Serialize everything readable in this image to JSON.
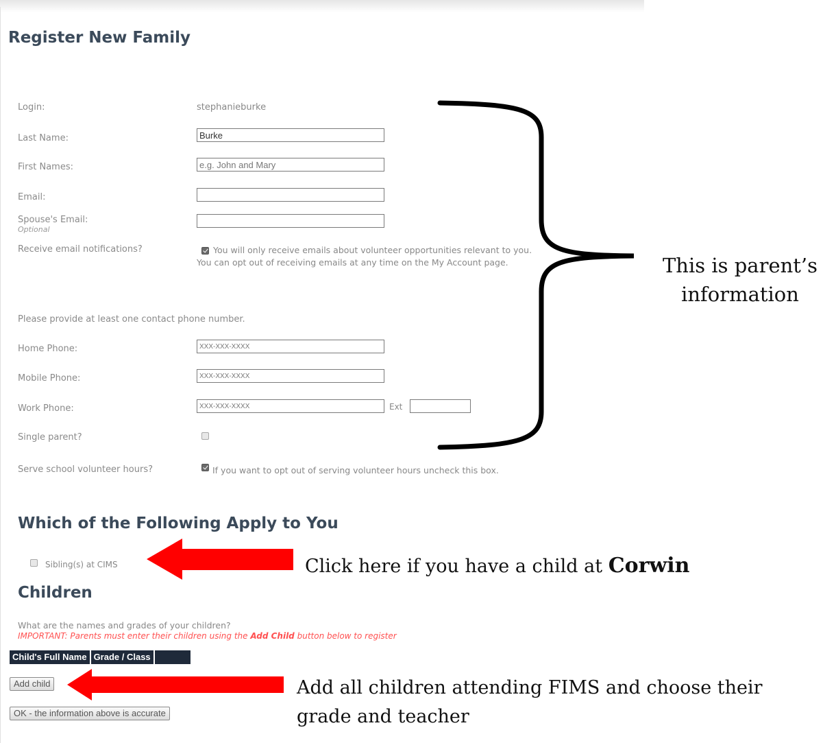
{
  "page_title": "Register New Family",
  "form": {
    "login_label": "Login:",
    "login_value": "stephanieburke",
    "last_name_label": "Last Name:",
    "last_name_value": "Burke",
    "first_names_label": "First Names:",
    "first_names_placeholder": "e.g. John and Mary",
    "email_label": "Email:",
    "spouse_email_label": "Spouse's Email:",
    "spouse_email_optional": "Optional",
    "notifications_label": "Receive email notifications?",
    "notifications_checked": true,
    "notifications_note_1": "You will only receive emails about volunteer opportunities relevant to you.",
    "notifications_note_2": "You can opt out of receiving emails at any time on the My Account page.",
    "phone_intro": "Please provide at least one contact phone number.",
    "home_phone_label": "Home Phone:",
    "home_phone_placeholder": "XXX-XXX-XXXX",
    "mobile_phone_label": "Mobile Phone:",
    "mobile_phone_placeholder": "XXX-XXX-XXXX",
    "work_phone_label": "Work Phone:",
    "work_phone_placeholder": "XXX-XXX-XXXX",
    "ext_label": "Ext",
    "single_parent_label": "Single parent?",
    "single_parent_checked": false,
    "volunteer_label": "Serve school volunteer hours?",
    "volunteer_checked": true,
    "volunteer_note": "If you want to opt out of serving volunteer hours uncheck this box."
  },
  "apply": {
    "heading": "Which of the Following Apply to You",
    "sibling_label": "Sibling(s) at CIMS",
    "sibling_checked": false
  },
  "children": {
    "heading": "Children",
    "question": "What are the names and grades of your children?",
    "important_prefix": "IMPORTANT: Parents must enter their children using the ",
    "important_bold": "Add Child",
    "important_suffix": " button below to register",
    "columns": [
      "Child's Full Name",
      "Grade / Class",
      ""
    ],
    "add_child_button": "Add child",
    "ok_button": "OK - the information above is accurate"
  },
  "annotations": {
    "parent_info_line1": "This is parent’s",
    "parent_info_line2": "information",
    "sibling_note_prefix": "Click here if you have a child at ",
    "sibling_note_bold": "Corwin",
    "add_child_note_line1": "Add all children attending FIMS and choose their",
    "add_child_note_line2": "grade and teacher",
    "arrow_color": "#ff0000",
    "brace_color": "#000000"
  }
}
